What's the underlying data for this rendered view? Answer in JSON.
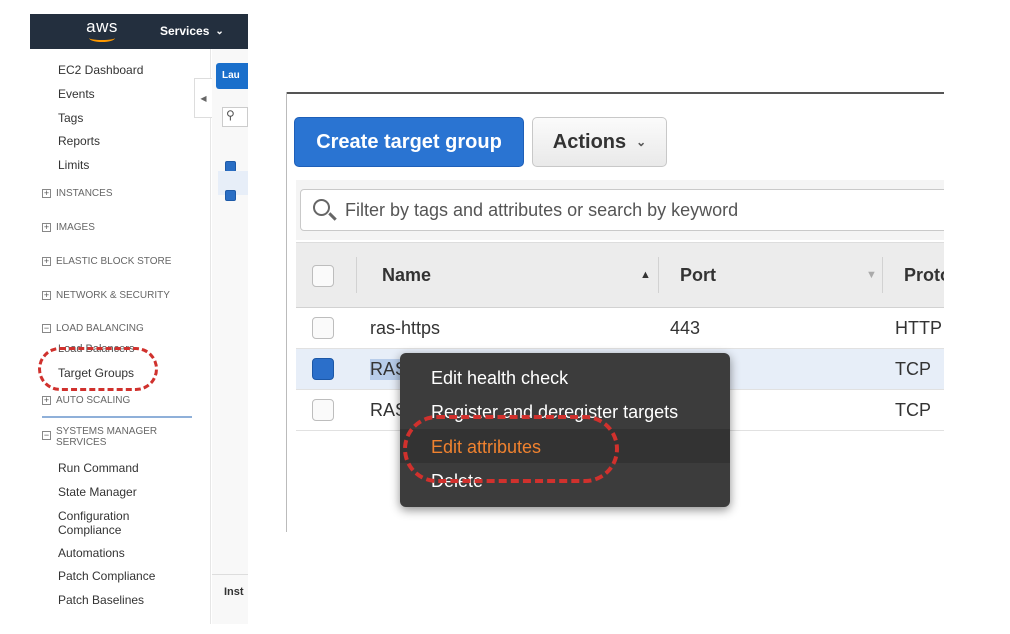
{
  "header": {
    "logo_text": "aws",
    "services_label": "Services",
    "services_chevron": "⌄"
  },
  "sidebar": {
    "items": [
      {
        "label": "EC2 Dashboard"
      },
      {
        "label": "Events"
      },
      {
        "label": "Tags"
      },
      {
        "label": "Reports"
      },
      {
        "label": "Limits"
      }
    ],
    "sections": {
      "instances": "INSTANCES",
      "images": "IMAGES",
      "ebs": "ELASTIC BLOCK STORE",
      "network": "NETWORK & SECURITY",
      "load_balancing": "LOAD BALANCING",
      "auto_scaling": "AUTO SCALING",
      "systems_manager": "SYSTEMS MANAGER SERVICES"
    },
    "lb_items": {
      "load_balancers": "Load Balancers",
      "target_groups": "Target Groups"
    },
    "ssm_items": [
      {
        "label": "Run Command"
      },
      {
        "label": "State Manager"
      },
      {
        "label": "Configuration Compliance"
      },
      {
        "label": "Automations"
      },
      {
        "label": "Patch Compliance"
      },
      {
        "label": "Patch Baselines"
      }
    ],
    "plus_symbol": "+",
    "minus_symbol": "−"
  },
  "strip": {
    "launch_label": "Lau",
    "search_glyph": "⚲",
    "bottom_label": "Inst",
    "collapse_glyph": "◀"
  },
  "toolbar": {
    "create_label": "Create target group",
    "actions_label": "Actions",
    "actions_chevron": "⌄"
  },
  "filter": {
    "placeholder": "Filter by tags and attributes or search by keyword"
  },
  "table": {
    "columns": {
      "name": "Name",
      "name_sort": "▲",
      "port": "Port",
      "port_sort": "▼",
      "protocol": "Proto"
    },
    "rows": [
      {
        "name": "ras-https",
        "port": "443",
        "protocol": "HTTP",
        "checked": false
      },
      {
        "name": "RAS",
        "port": "",
        "protocol": "TCP",
        "checked": true
      },
      {
        "name": "RAS",
        "port": "",
        "protocol": "TCP",
        "checked": false
      }
    ]
  },
  "context_menu": {
    "items": [
      {
        "label": "Edit health check"
      },
      {
        "label": "Register and deregister targets"
      },
      {
        "label": "Edit attributes"
      },
      {
        "label": "Delete"
      }
    ]
  },
  "colors": {
    "aws_nav": "#232f3e",
    "aws_orange": "#ff9900",
    "primary_button": "#2a74d2",
    "menu_bg": "#3c3c3c",
    "menu_highlight_text": "#f0822f",
    "annotation_red": "#d0312d"
  }
}
